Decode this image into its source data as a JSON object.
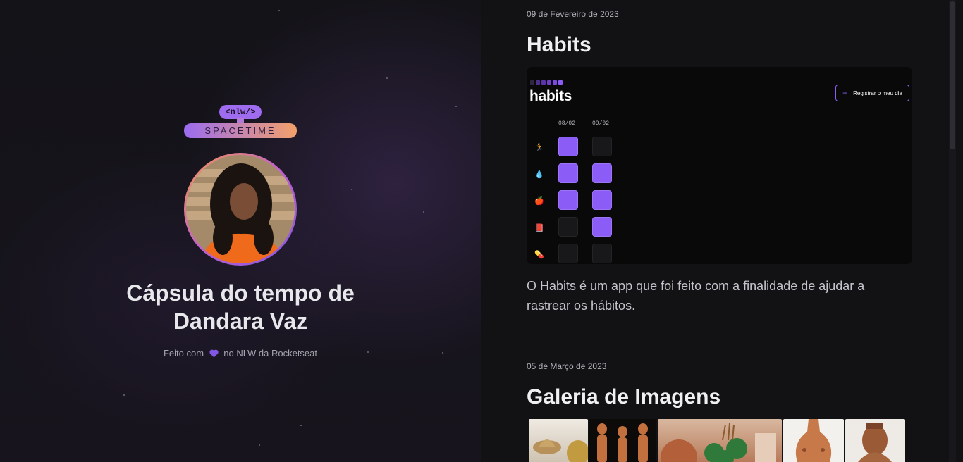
{
  "hero": {
    "logo_top": "<nlw/>",
    "logo_bottom": "SPACETIME",
    "title_prefix": "Cápsula do tempo de",
    "title_name": "Dandara Vaz",
    "footer_before": "Feito com",
    "footer_after": "no NLW da Rocketseat",
    "accent": "#8257e5"
  },
  "memories": [
    {
      "date": "09 de Fevereiro de 2023",
      "title": "Habits",
      "text": "O Habits é um app que foi feito com a finalidade de ajudar a rastrear os hábitos.",
      "preview": {
        "logo": "habits",
        "button_label": "Registrar o meu dia",
        "columns": [
          "08/02",
          "09/02"
        ],
        "rows": [
          {
            "icon": "runner-icon",
            "glyph": "🏃",
            "cells": [
              true,
              false
            ]
          },
          {
            "icon": "water-drop-icon",
            "glyph": "💧",
            "cells": [
              true,
              true
            ]
          },
          {
            "icon": "apple-icon",
            "glyph": "🍎",
            "cells": [
              true,
              true
            ]
          },
          {
            "icon": "book-icon",
            "glyph": "📕",
            "cells": [
              false,
              true
            ]
          },
          {
            "icon": "pill-icon",
            "glyph": "💊",
            "cells": [
              false,
              false
            ]
          }
        ]
      }
    },
    {
      "date": "05 de Março de 2023",
      "title": "Galeria de Imagens",
      "gallery": [
        "ceramic-hat-photo",
        "clay-figures-photo",
        "pottery-plants-photo",
        "clay-vase-photo",
        "clay-bust-photo"
      ]
    }
  ],
  "colors": {
    "purple": "#8b5cf6",
    "background": "#121215"
  }
}
